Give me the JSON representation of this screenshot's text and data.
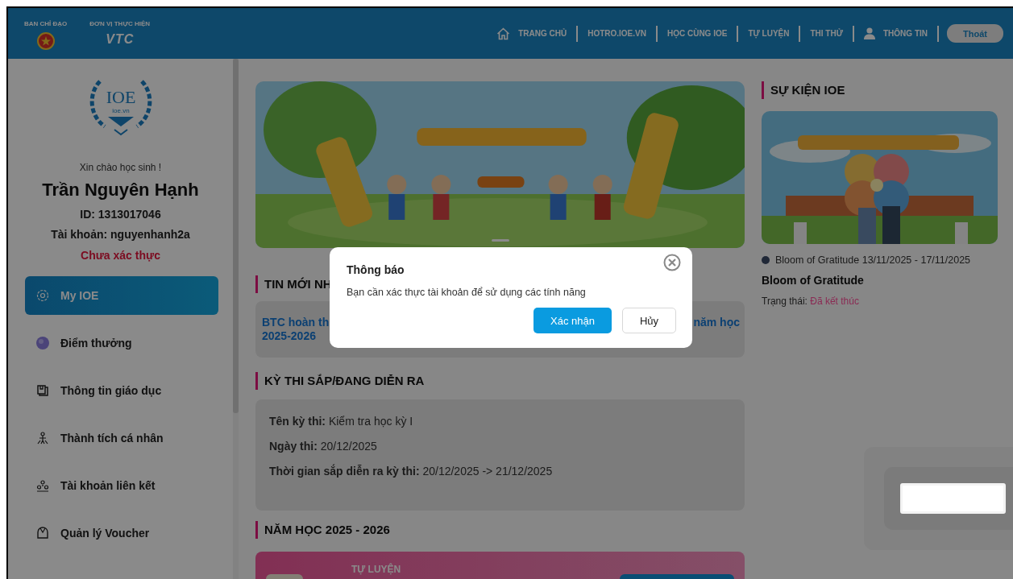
{
  "header": {
    "sponsors": [
      {
        "label": "BAN CHỈ ĐẠO",
        "kind": "emblem"
      },
      {
        "label": "ĐƠN VỊ THỰC HIỆN",
        "kind": "wordmark",
        "logo_text": "VTC"
      }
    ],
    "nav": [
      {
        "label": "TRANG CHỦ",
        "kind": "home"
      },
      {
        "label": "HOTRO.IOE.VN",
        "kind": "plain"
      },
      {
        "label": "HỌC CÙNG IOE",
        "kind": "plain"
      },
      {
        "label": "TỰ LUYỆN",
        "kind": "plain"
      },
      {
        "label": "THI THỬ",
        "kind": "plain"
      },
      {
        "label": "THÔNG TIN",
        "kind": "user"
      }
    ],
    "logout": "Thoát"
  },
  "sidebar": {
    "logo": {
      "title": "IOE",
      "subtitle": "ioe.vn"
    },
    "greeting": "Xin chào học sinh !",
    "name": "Trần Nguyên Hạnh",
    "id": "ID: 1313017046",
    "account": "Tài khoản: nguyenhanh2a",
    "status": "Chưa xác thực",
    "items": [
      {
        "label": "My IOE",
        "kind": "myioe",
        "selected": true
      },
      {
        "label": "Điểm thưởng",
        "kind": "points",
        "selected": false
      },
      {
        "label": "Thông tin giáo dục",
        "kind": "edu",
        "selected": false
      },
      {
        "label": "Thành tích cá nhân",
        "kind": "achievement",
        "selected": false
      },
      {
        "label": "Tài khoản liên kết",
        "kind": "linked",
        "selected": false
      },
      {
        "label": "Quản lý Voucher",
        "kind": "voucher",
        "selected": false
      }
    ]
  },
  "news": {
    "heading": "TIN MỚI NH",
    "title_left": [
      "BTC hoàn th",
      "2025-2026"
    ],
    "title_right": "năm học"
  },
  "exams": {
    "heading": "KỲ THI SẮP/ĐANG DIỄN RA",
    "rows": [
      {
        "label": "Tên kỳ thi:",
        "value": "Kiểm tra học kỳ I"
      },
      {
        "label": "Ngày thi:",
        "value": "20/12/2025"
      },
      {
        "label": "Thời gian sắp diễn ra kỳ thi:",
        "value": "20/12/2025 -> 21/12/2025"
      }
    ]
  },
  "school_year": {
    "heading": "NĂM HỌC 2025 - 2026",
    "card_label": "TỰ LUYỆN"
  },
  "events": {
    "heading": "SỰ KIỆN IOE",
    "items": [
      {
        "kind": "picture",
        "caption": "Bloom of Gratitude 13/11/2025 - 17/11/2025",
        "title": "Bloom of Gratitude",
        "status_label": "Trạng thái:",
        "status": "Đã kết thúc"
      }
    ]
  },
  "dialog": {
    "title": "Thông báo",
    "message": "Bạn cần xác thực tài khoản để sử dụng các tính năng",
    "buttons": [
      {
        "label": "Xác nhận",
        "kind": "primary"
      },
      {
        "label": "Hủy",
        "kind": "secondary"
      }
    ]
  }
}
